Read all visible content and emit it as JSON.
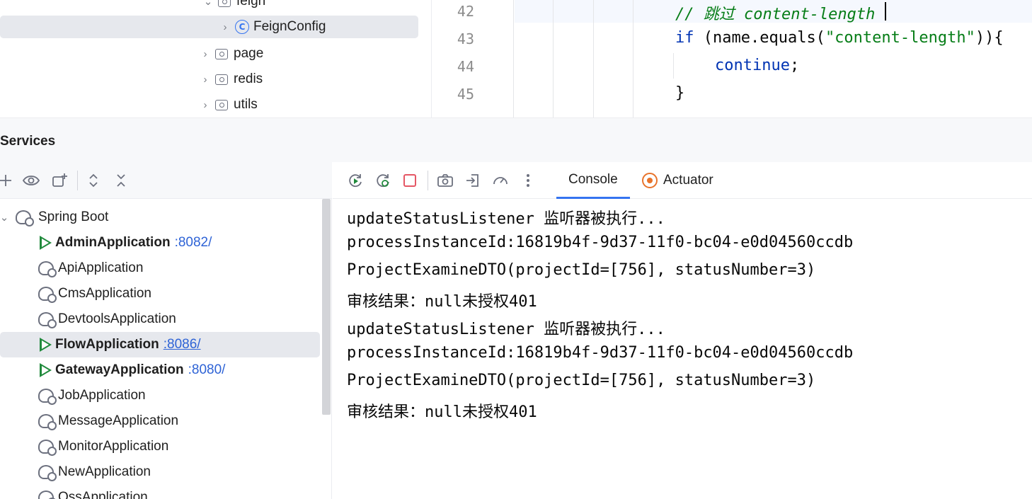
{
  "project_tree": {
    "items": [
      {
        "label": "feign",
        "kind": "folder",
        "expanded": true
      },
      {
        "label": "FeignConfig",
        "kind": "class",
        "selected": true
      },
      {
        "label": "page",
        "kind": "folder",
        "expanded": false
      },
      {
        "label": "redis",
        "kind": "folder",
        "expanded": false
      },
      {
        "label": "utils",
        "kind": "folder",
        "expanded": false
      }
    ]
  },
  "editor": {
    "lines": [
      {
        "number": "42",
        "comment": "// 跳过 content-length"
      },
      {
        "number": "43",
        "kw": "if",
        "rest_a": " (name.equals(",
        "str": "\"content-length\"",
        "rest_b": ")){"
      },
      {
        "number": "44",
        "kw": "continue",
        "rest": ";"
      },
      {
        "number": "45",
        "text": "}"
      }
    ]
  },
  "services": {
    "title": "Services",
    "root_label": "Spring Boot",
    "apps": [
      {
        "name": "AdminApplication",
        "port": ":8082/",
        "running": true
      },
      {
        "name": "ApiApplication",
        "port": "",
        "running": false
      },
      {
        "name": "CmsApplication",
        "port": "",
        "running": false
      },
      {
        "name": "DevtoolsApplication",
        "port": "",
        "running": false
      },
      {
        "name": "FlowApplication",
        "port": ":8086/",
        "running": true,
        "selected": true
      },
      {
        "name": "GatewayApplication",
        "port": ":8080/",
        "running": true
      },
      {
        "name": "JobApplication",
        "port": "",
        "running": false
      },
      {
        "name": "MessageApplication",
        "port": "",
        "running": false
      },
      {
        "name": "MonitorApplication",
        "port": "",
        "running": false
      },
      {
        "name": "NewApplication",
        "port": "",
        "running": false
      },
      {
        "name": "OssApplication",
        "port": "",
        "running": false
      }
    ]
  },
  "tabs": {
    "console": "Console",
    "actuator": "Actuator"
  },
  "console": {
    "lines": [
      "updateStatusListener 监听器被执行...",
      "processInstanceId:16819b4f-9d37-11f0-bc04-e0d04560ccdb",
      "ProjectExamineDTO(projectId=[756], statusNumber=3)",
      "审核结果：null未授权401",
      "updateStatusListener 监听器被执行...",
      "processInstanceId:16819b4f-9d37-11f0-bc04-e0d04560ccdb",
      "ProjectExamineDTO(projectId=[756], statusNumber=3)",
      "审核结果：null未授权401"
    ]
  },
  "colors": {
    "accent": "#3574f0",
    "run_green": "#208a3c",
    "link_blue": "#2e63d6",
    "keyword": "#0033b3",
    "string": "#067d17",
    "stop_red": "#e55765",
    "actuator_orange": "#e8732b"
  }
}
